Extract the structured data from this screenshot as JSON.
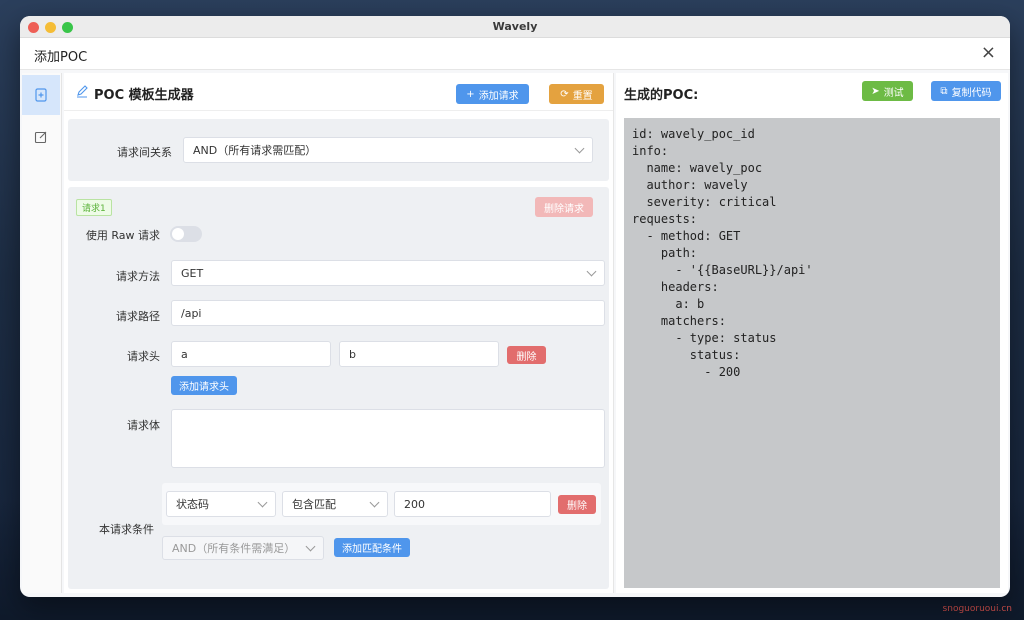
{
  "window": {
    "title": "Wavely"
  },
  "dialog": {
    "title": "添加POC",
    "close": "×"
  },
  "sidebar": {
    "items": [
      "poc-generator",
      "editor"
    ]
  },
  "generator": {
    "title": "POC 模板生成器",
    "add_request_label": "添加请求",
    "reset_label": "重置",
    "relation_label": "请求间关系",
    "relation_value": "AND（所有请求需匹配）",
    "request": {
      "tag": "请求1",
      "delete_label": "删除请求",
      "raw_label": "使用 Raw 请求",
      "raw_enabled": false,
      "method_label": "请求方法",
      "method_value": "GET",
      "path_label": "请求路径",
      "path_value": "/api",
      "headers_label": "请求头",
      "header_key": "a",
      "header_value": "b",
      "header_delete_label": "删除",
      "add_header_label": "添加请求头",
      "body_label": "请求体",
      "body_value": "",
      "conditions_label": "本请求条件",
      "condition_type": "状态码",
      "condition_op": "包含匹配",
      "condition_value": "200",
      "condition_delete_label": "删除",
      "condition_relation": "AND（所有条件需满足）",
      "add_condition_label": "添加匹配条件"
    }
  },
  "output": {
    "title": "生成的POC:",
    "test_label": "测试",
    "copy_label": "复制代码",
    "code": "id: wavely_poc_id\ninfo:\n  name: wavely_poc\n  author: wavely\n  severity: critical\nrequests:\n  - method: GET\n    path:\n      - '{{BaseURL}}/api'\n    headers:\n      a: b\n    matchers:\n      - type: status\n        status:\n          - 200"
  },
  "watermark": "snoguoruoui.cn",
  "colors": {
    "primary": "#4f96ec",
    "warning": "#e4a23f",
    "success": "#6dbb45",
    "danger": "#e26d6d"
  }
}
